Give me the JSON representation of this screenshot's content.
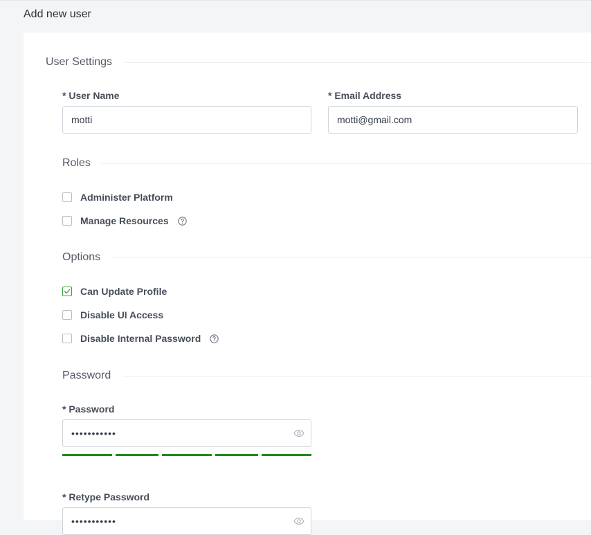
{
  "page": {
    "title": "Add new user"
  },
  "sections": {
    "user_settings": "User Settings",
    "roles": "Roles",
    "options": "Options",
    "password": "Password"
  },
  "user_settings": {
    "username_label": "* User Name",
    "username_value": "motti",
    "email_label": "* Email Address",
    "email_value": "motti@gmail.com"
  },
  "roles": {
    "items": [
      {
        "label": "Administer Platform",
        "checked": false
      },
      {
        "label": "Manage Resources",
        "checked": false,
        "help": true
      }
    ]
  },
  "options": {
    "items": [
      {
        "label": "Can Update Profile",
        "checked": true
      },
      {
        "label": "Disable UI Access",
        "checked": false
      },
      {
        "label": "Disable Internal Password",
        "checked": false,
        "help": true
      }
    ]
  },
  "password": {
    "password_label": "* Password",
    "password_value": "•••••••••••",
    "retype_label": "* Retype Password",
    "retype_value": "•••••••••••",
    "strength_level": 1.0
  },
  "colors": {
    "accent_green": "#1f8a1f",
    "checkbox_checked": "#3aa13a"
  },
  "icons": {
    "help": "question-circle-icon",
    "eye": "eye-icon",
    "check": "checkmark-icon"
  }
}
